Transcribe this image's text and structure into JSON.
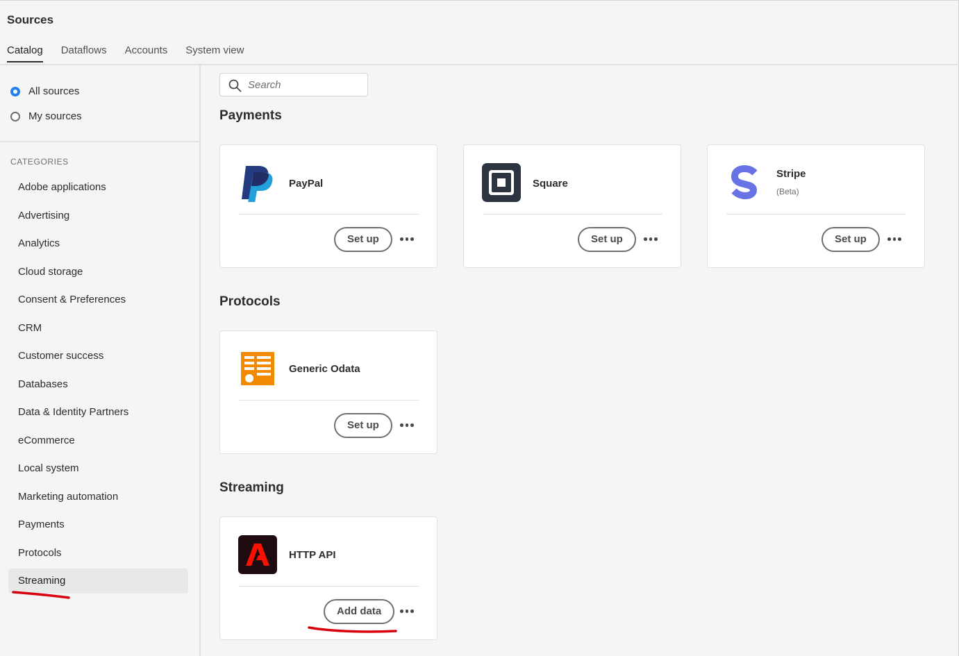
{
  "header": {
    "title": "Sources"
  },
  "tabs": [
    {
      "label": "Catalog"
    },
    {
      "label": "Dataflows"
    },
    {
      "label": "Accounts"
    },
    {
      "label": "System view"
    }
  ],
  "filters": [
    {
      "label": "All sources",
      "checked": true
    },
    {
      "label": "My sources",
      "checked": false
    }
  ],
  "categories": {
    "heading": "CATEGORIES",
    "items": [
      {
        "label": "Adobe applications"
      },
      {
        "label": "Advertising"
      },
      {
        "label": "Analytics"
      },
      {
        "label": "Cloud storage"
      },
      {
        "label": "Consent & Preferences"
      },
      {
        "label": "CRM"
      },
      {
        "label": "Customer success"
      },
      {
        "label": "Databases"
      },
      {
        "label": "Data & Identity Partners"
      },
      {
        "label": "eCommerce"
      },
      {
        "label": "Local system"
      },
      {
        "label": "Marketing automation"
      },
      {
        "label": "Payments"
      },
      {
        "label": "Protocols"
      },
      {
        "label": "Streaming"
      }
    ],
    "selected": "Streaming"
  },
  "search": {
    "placeholder": "Search"
  },
  "sections": {
    "payments": {
      "title": "Payments",
      "cards": [
        {
          "name": "PayPal",
          "subtitle": "",
          "button": "Set up",
          "icon": "paypal-logo"
        },
        {
          "name": "Square",
          "subtitle": "",
          "button": "Set up",
          "icon": "square-logo"
        },
        {
          "name": "Stripe",
          "subtitle": "(Beta)",
          "button": "Set up",
          "icon": "stripe-logo"
        }
      ]
    },
    "protocols": {
      "title": "Protocols",
      "cards": [
        {
          "name": "Generic Odata",
          "subtitle": "",
          "button": "Set up",
          "icon": "odata-logo"
        }
      ]
    },
    "streaming": {
      "title": "Streaming",
      "cards": [
        {
          "name": "HTTP API",
          "subtitle": "",
          "button": "Add data",
          "icon": "adobe-logo"
        }
      ]
    }
  },
  "colors": {
    "accent": "#2680eb",
    "annotation": "#d7000f",
    "paypal_dark": "#253b80",
    "paypal_light": "#179bd7",
    "square": "#2b3440",
    "stripe": "#6772e5",
    "odata": "#f18a00",
    "adobe_bg": "#1e0b10",
    "adobe_red": "#fa0f00"
  }
}
